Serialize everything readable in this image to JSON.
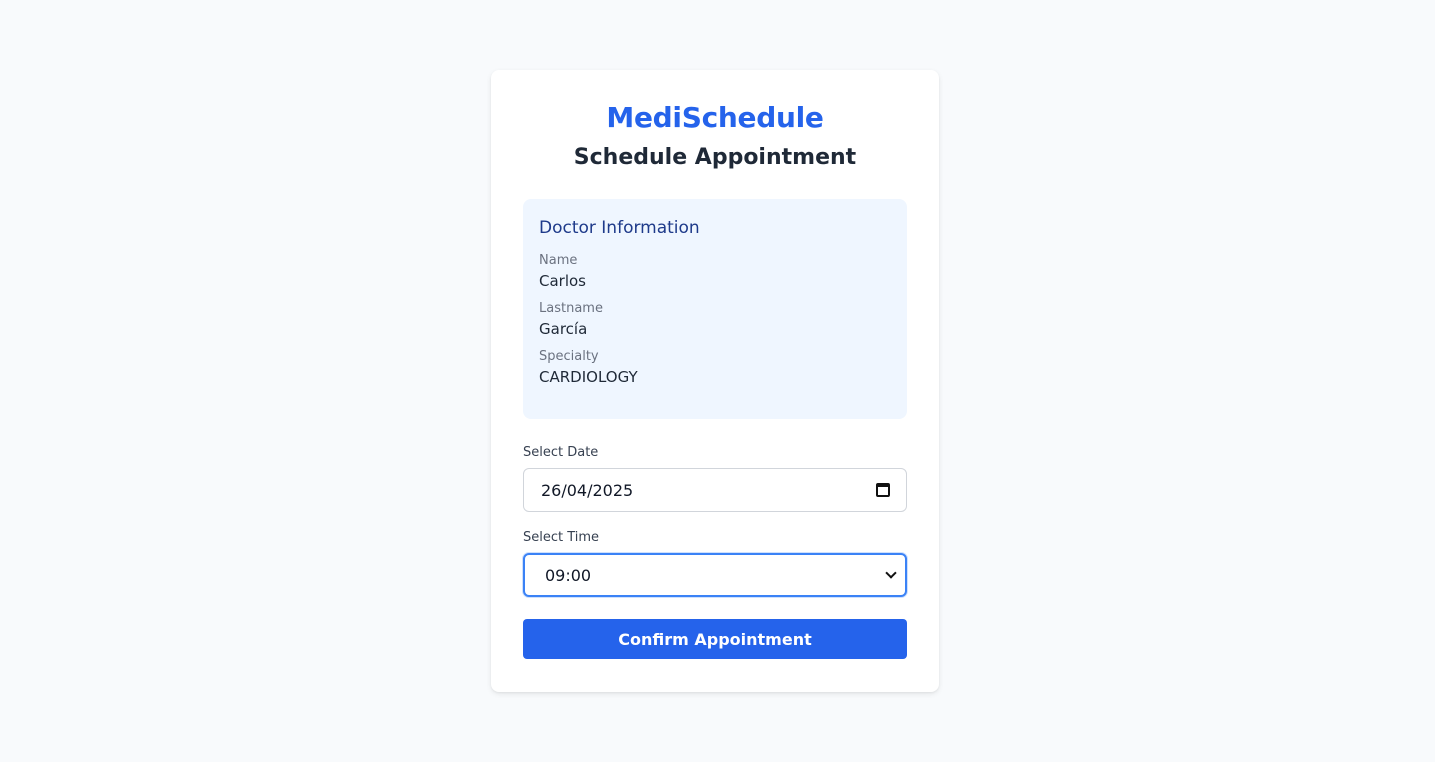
{
  "brand": "MediSchedule",
  "title": "Schedule Appointment",
  "doctor": {
    "heading": "Doctor Information",
    "fields": [
      {
        "label": "Name",
        "value": "Carlos"
      },
      {
        "label": "Lastname",
        "value": "García"
      },
      {
        "label": "Specialty",
        "value": "CARDIOLOGY"
      }
    ]
  },
  "form": {
    "date_label": "Select Date",
    "date_value": "26/04/2025",
    "time_label": "Select Time",
    "time_value": "09:00",
    "confirm_label": "Confirm Appointment"
  },
  "icons": {
    "date": "calendar-icon",
    "time": "chevron-down-icon"
  },
  "colors": {
    "brand": "#2563eb",
    "page_bg": "#f8fafc",
    "info_bg": "#eff6ff",
    "info_heading": "#1e3a8a",
    "focus_border": "#3b82f6"
  }
}
